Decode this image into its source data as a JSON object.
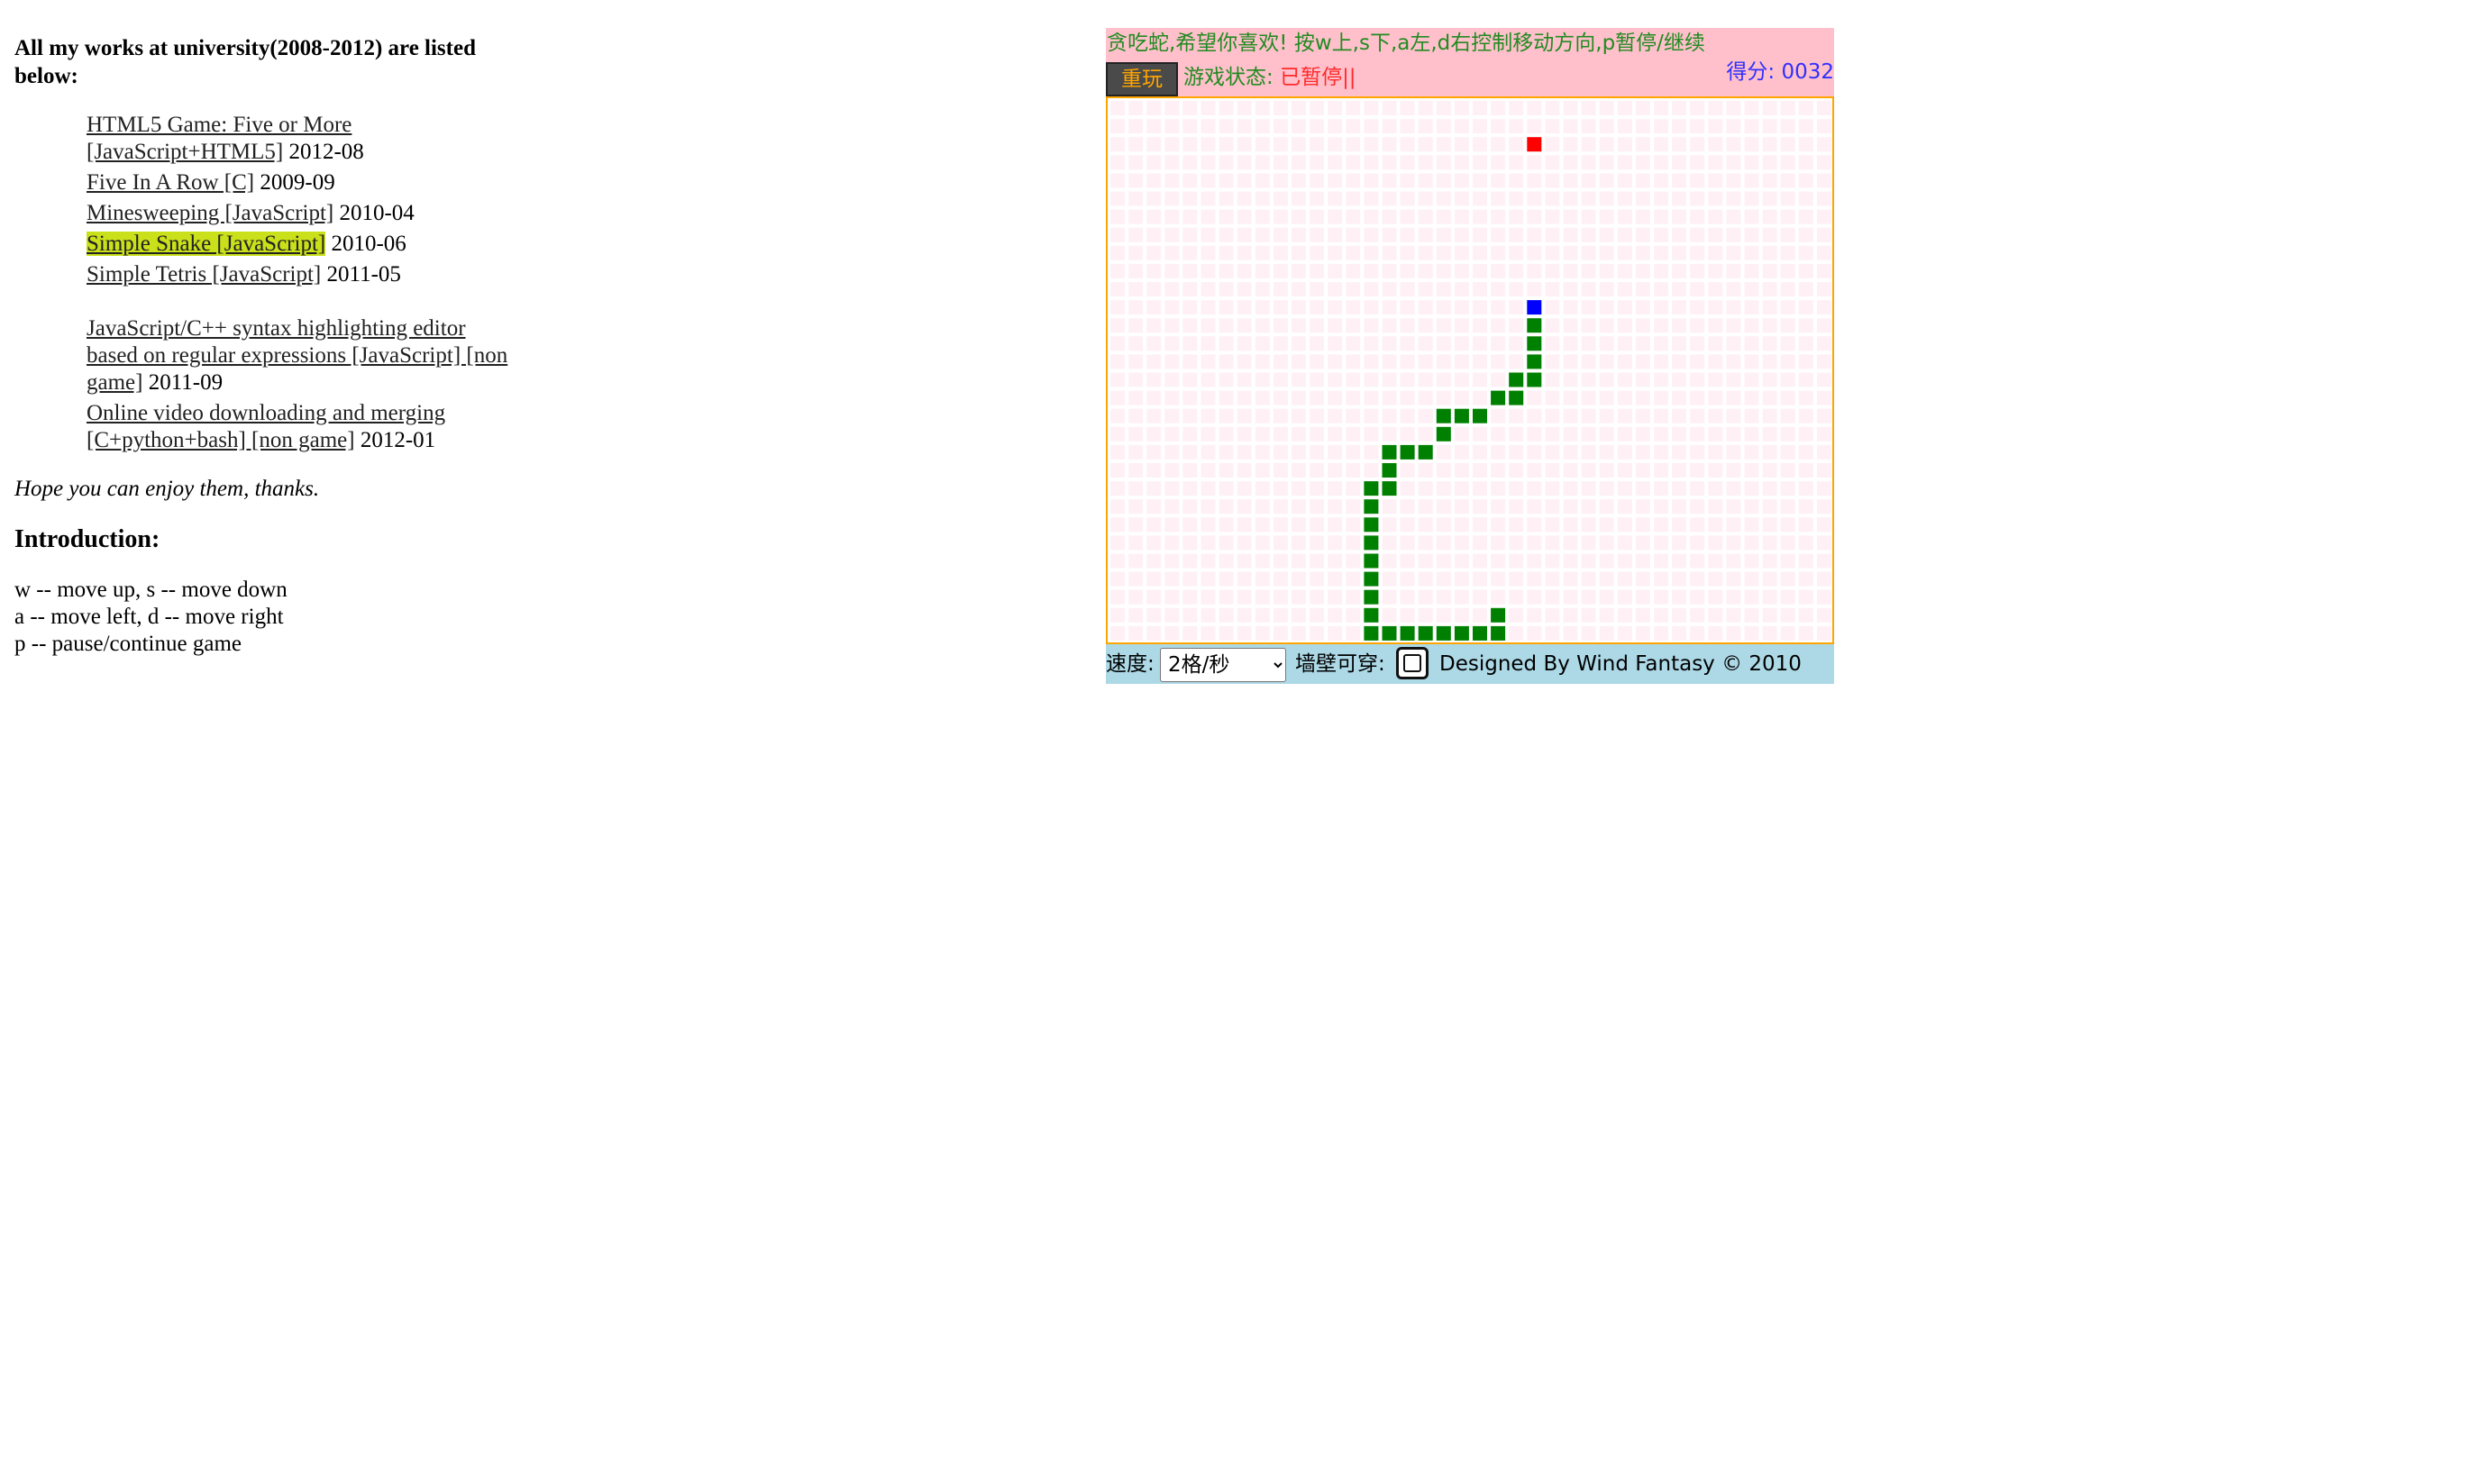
{
  "page": {
    "heading": "All my works at university(2008-2012) are listed below:",
    "works": [
      {
        "link": "HTML5 Game: Five or More [JavaScript+HTML5]",
        "date": "2012-08",
        "current": false
      },
      {
        "link": "Five In A Row [C]",
        "date": "2009-09",
        "current": false
      },
      {
        "link": "Minesweeping [JavaScript]",
        "date": "2010-04",
        "current": false
      },
      {
        "link": "Simple Snake [JavaScript]",
        "date": "2010-06",
        "current": true
      },
      {
        "link": "Simple Tetris [JavaScript]",
        "date": "2011-05",
        "current": false
      }
    ],
    "other_works": [
      {
        "link": "JavaScript/C++ syntax highlighting editor based on regular expressions [JavaScript] [non game]",
        "date": "2011-09"
      },
      {
        "link": "Online video downloading and merging [C+python+bash] [non game]",
        "date": "2012-01"
      }
    ],
    "hope": "Hope you can enjoy them, thanks.",
    "intro_title": "Introduction:",
    "controls": [
      "w -- move up,  s -- move down",
      "a -- move left, d -- move right",
      "p -- pause/continue game"
    ]
  },
  "game": {
    "tip": "贪吃蛇,希望你喜欢! 按w上,s下,a左,d右控制移动方向,p暂停/继续",
    "replay_label": "重玩",
    "status_label": "游戏状态: ",
    "status_value": "已暂停||",
    "score_text": "得分: 0032",
    "speed_label": "速度:",
    "speed_value": "2格/秒",
    "wall_label": "墙壁可穿:",
    "wall_through": false,
    "credit": "Designed By Wind Fantasy © 2010",
    "colors": {
      "empty_cell": "#fff0f5",
      "snake_body": "#008000",
      "snake_head": "#0000ff",
      "food": "#ff0000"
    },
    "grid": {
      "cols": 40,
      "rows": 30
    },
    "food": [
      23,
      2
    ],
    "snake_head": [
      23,
      11
    ],
    "snake_body": [
      [
        23,
        12
      ],
      [
        23,
        13
      ],
      [
        23,
        14
      ],
      [
        23,
        15
      ],
      [
        22,
        15
      ],
      [
        22,
        16
      ],
      [
        21,
        16
      ],
      [
        20,
        17
      ],
      [
        19,
        17
      ],
      [
        18,
        17
      ],
      [
        18,
        18
      ],
      [
        17,
        19
      ],
      [
        16,
        19
      ],
      [
        15,
        19
      ],
      [
        15,
        20
      ],
      [
        15,
        21
      ],
      [
        14,
        21
      ],
      [
        14,
        22
      ],
      [
        14,
        23
      ],
      [
        14,
        24
      ],
      [
        14,
        25
      ],
      [
        14,
        26
      ],
      [
        14,
        27
      ],
      [
        14,
        28
      ],
      [
        14,
        29
      ],
      [
        15,
        29
      ],
      [
        16,
        29
      ],
      [
        17,
        29
      ],
      [
        18,
        29
      ],
      [
        19,
        29
      ],
      [
        20,
        29
      ],
      [
        21,
        29
      ],
      [
        21,
        28
      ]
    ]
  }
}
